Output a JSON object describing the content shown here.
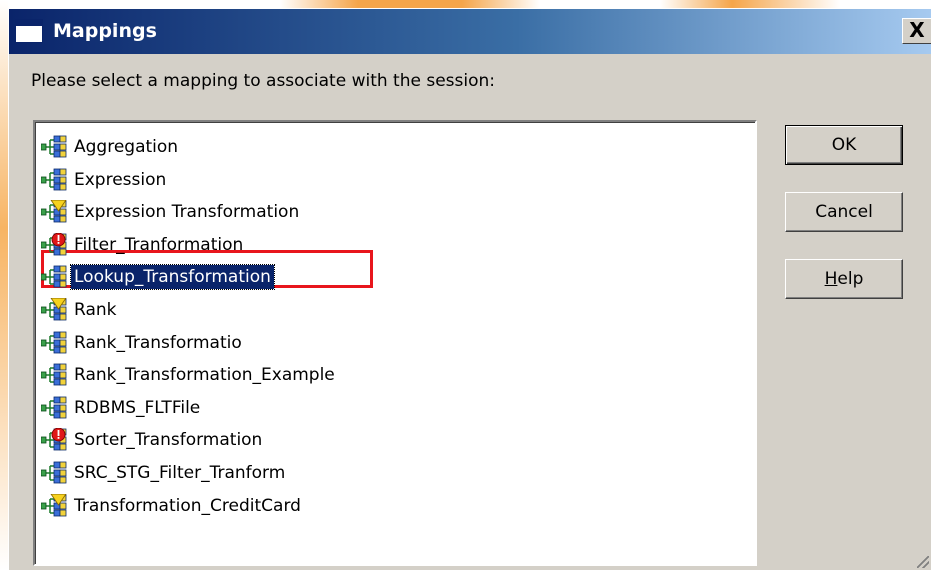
{
  "dialog": {
    "title": "Mappings",
    "close_label": "X",
    "prompt": "Please select a mapping to associate with the session:"
  },
  "mappings": [
    {
      "label": "Aggregation",
      "status": "valid",
      "icon": "mapping-icon"
    },
    {
      "label": "Expression",
      "status": "valid",
      "icon": "mapping-icon"
    },
    {
      "label": "Expression Transformation",
      "status": "warning",
      "icon": "mapping-warning-icon"
    },
    {
      "label": "Filter_Tranformation",
      "status": "invalid",
      "icon": "mapping-error-icon"
    },
    {
      "label": "Lookup_Transformation",
      "status": "valid",
      "icon": "mapping-icon",
      "selected": true
    },
    {
      "label": "Rank",
      "status": "warning",
      "icon": "mapping-warning-icon"
    },
    {
      "label": "Rank_Transformatio",
      "status": "valid",
      "icon": "mapping-icon"
    },
    {
      "label": "Rank_Transformation_Example",
      "status": "valid",
      "icon": "mapping-icon"
    },
    {
      "label": "RDBMS_FLTFile",
      "status": "valid",
      "icon": "mapping-icon"
    },
    {
      "label": "Sorter_Transformation",
      "status": "invalid",
      "icon": "mapping-error-icon"
    },
    {
      "label": "SRC_STG_Filter_Tranform",
      "status": "valid",
      "icon": "mapping-icon"
    },
    {
      "label": "Transformation_CreditCard",
      "status": "warning",
      "icon": "mapping-warning-icon"
    }
  ],
  "buttons": {
    "ok": "OK",
    "cancel": "Cancel",
    "help_mnemonic": "H",
    "help_rest": "elp"
  },
  "colors": {
    "selection": "#0a246a",
    "highlight_box": "#e8161c",
    "dialog_face": "#d4d0c8"
  }
}
